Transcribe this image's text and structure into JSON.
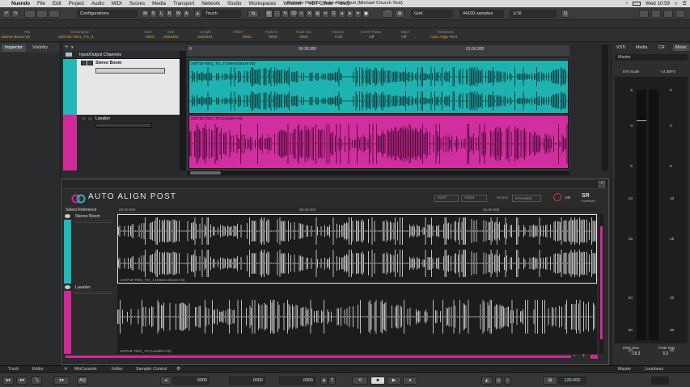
{
  "menubar": {
    "app_name": "Nuendo",
    "items": [
      "File",
      "Edit",
      "Project",
      "Audio",
      "MIDI",
      "Scores",
      "Media",
      "Transport",
      "Network",
      "Studio",
      "Workspaces",
      "Window",
      "VST Cloud",
      "Help"
    ],
    "window_title": "Nuendo Project - Auto-Align Post (Michael Church Test)",
    "clock": "Wed 10:59"
  },
  "toolbar": {
    "configurations": "Configurations",
    "mode_buttons": [
      "M",
      "S",
      "L",
      "R",
      "W",
      "A"
    ],
    "touch": "Touch",
    "grid": "Grid",
    "sample_rate": "44100 samples",
    "quantize": "1/16"
  },
  "infoline": {
    "labels": [
      "File",
      "Description",
      "Start",
      "End",
      "Length",
      "Offset",
      "Fade In",
      "Fade Out",
      "Volume",
      "Invert Phase",
      "Mute",
      "Transpose"
    ],
    "values": [
      "Stereo Boom-03",
      "240718-T001_Tr1_2",
      "0000",
      "3494404",
      "3494404",
      "0000",
      "0000",
      "0000",
      "0.00",
      "Off",
      "Off",
      "Auto-Align Post"
    ]
  },
  "leftzone": {
    "tabs": [
      "Inspector",
      "Visibility"
    ]
  },
  "project": {
    "folder": "Input/Output Channels",
    "tracks": [
      {
        "name": "Stereo Boom",
        "color": "#20b9b6",
        "event_label": "240718-T001_Tr1_2 (Stereo Boom-03)"
      },
      {
        "name": "Lavalier",
        "color": "#d02a98",
        "event_label": "240718-T001_Tr3 (Lavalier-03)"
      }
    ],
    "ruler_ticks": [
      "0",
      "00:30.000",
      "01:00.000"
    ]
  },
  "rightzone": {
    "tabs": [
      "VSTi",
      "Media",
      "CR",
      "Meter"
    ],
    "master": "Master",
    "meter_header_left": "DIN Scale",
    "meter_header_right": "-14 dBFS",
    "scale": [
      "5",
      "0",
      "5",
      "10",
      "15",
      "20",
      "30",
      "40",
      "50"
    ],
    "rms_label": "RMS Max",
    "rms_value": "-19.3",
    "peak_label": "Peak Max",
    "peak_value": "3.3",
    "bottom_tabs": [
      "Master",
      "Loudness"
    ]
  },
  "plugin": {
    "title": "AUTO ALIGN POST",
    "select_reference": "Select Reference",
    "edit": "EDIT",
    "view": "VIEW",
    "mode_label": "MODE",
    "mode_value": "DYNAMIC",
    "on": "ON",
    "brand": "SoundRadix",
    "ruler_ticks": [
      "00:00.000",
      "00:30.000",
      "01:00.000"
    ],
    "tracks": [
      {
        "name": "Stereo Boom",
        "label": "240718-T001_Tr1_2 (Stereo Boom-03)"
      },
      {
        "name": "Lavalier",
        "label": "240718-T001_Tr3 (Lavalier-03)"
      }
    ]
  },
  "bottomtabs": {
    "left": [
      "Track",
      "Editor"
    ],
    "mid": [
      "MixConsole",
      "Editor",
      "Sampler Control"
    ]
  },
  "transport": {
    "aq": "AQ",
    "pos1": "0000",
    "pos2": "0000",
    "pos3": "0000",
    "tempo": "120.000"
  }
}
